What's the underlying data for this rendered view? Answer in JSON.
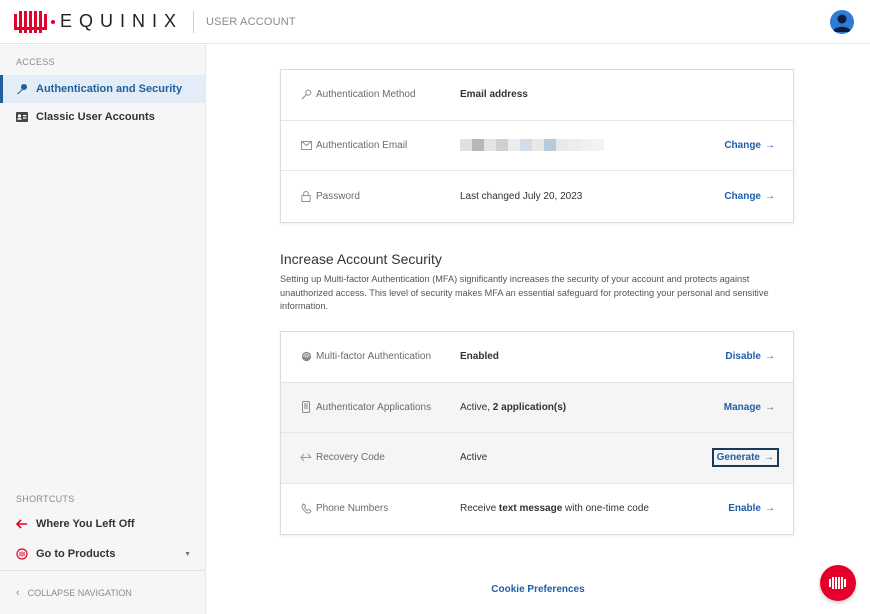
{
  "header": {
    "brand": "EQUINIX",
    "app_title": "USER ACCOUNT"
  },
  "sidebar": {
    "access_label": "ACCESS",
    "items": [
      {
        "label": "Authentication and Security",
        "icon": "key-icon",
        "active": true
      },
      {
        "label": "Classic User Accounts",
        "icon": "id-card-icon",
        "active": false
      }
    ],
    "shortcuts_label": "SHORTCUTS",
    "shortcuts": [
      {
        "label": "Where You Left Off",
        "icon": "arrow-left-icon"
      },
      {
        "label": "Go to Products",
        "icon": "products-icon"
      }
    ],
    "collapse_label": "COLLAPSE NAVIGATION"
  },
  "auth_card": {
    "rows": [
      {
        "label": "Authentication Method",
        "icon": "key-outline-icon",
        "value": "Email address"
      },
      {
        "label": "Authentication Email",
        "icon": "mail-icon",
        "value": "",
        "action": "Change"
      },
      {
        "label": "Password",
        "icon": "lock-icon",
        "value": "Last changed July 20, 2023",
        "action": "Change"
      }
    ]
  },
  "security": {
    "title": "Increase Account Security",
    "description": "Setting up Multi-factor Authentication (MFA) significantly increases the security of your account and protects against unauthorized access. This level of security makes MFA an essential safeguard for protecting your personal and sensitive information."
  },
  "mfa_card": {
    "rows": [
      {
        "label": "Multi-factor Authentication",
        "icon": "fingerprint-icon",
        "value": "Enabled",
        "action": "Disable"
      },
      {
        "label": "Authenticator Applications",
        "icon": "phone-icon",
        "value_prefix": "Active, ",
        "value_bold": "2 application(s)",
        "action": "Manage"
      },
      {
        "label": "Recovery Code",
        "icon": "recovery-icon",
        "value": "Active",
        "action": "Generate"
      },
      {
        "label": "Phone Numbers",
        "icon": "phone-handset-icon",
        "value_prefix": "Receive ",
        "value_bold": "text message",
        "value_suffix": " with one-time code",
        "action": "Enable"
      }
    ]
  },
  "footer": {
    "cookie": "Cookie Preferences"
  },
  "colors": {
    "accent": "#1f5fa8",
    "brand_red": "#e4002b",
    "active_nav_bg": "#e2edf8"
  }
}
